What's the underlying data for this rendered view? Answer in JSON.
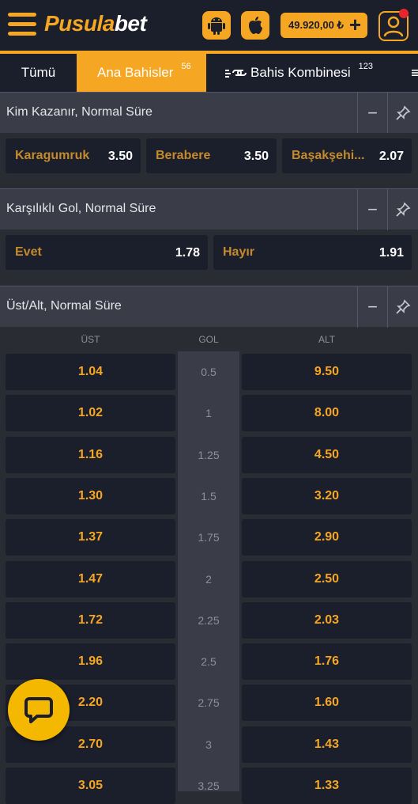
{
  "header": {
    "logo_part1": "Pusula",
    "logo_part2": "bet",
    "balance": "49.920,00 ₺",
    "balance_plus": "+"
  },
  "tabs": [
    {
      "label": "Tümü",
      "count": ""
    },
    {
      "label": "Ana Bahisler",
      "count": "56"
    },
    {
      "label": "Bahis Kombinesi",
      "count": "123"
    }
  ],
  "sections": {
    "winner": {
      "title": "Kim Kazanır, Normal Süre",
      "options": [
        {
          "label": "Karagumruk",
          "odd": "3.50"
        },
        {
          "label": "Berabere",
          "odd": "3.50"
        },
        {
          "label": "Başakşehi...",
          "odd": "2.07"
        }
      ]
    },
    "btts": {
      "title": "Karşılıklı Gol, Normal Süre",
      "options": [
        {
          "label": "Evet",
          "odd": "1.78"
        },
        {
          "label": "Hayır",
          "odd": "1.91"
        }
      ]
    },
    "overunder": {
      "title": "Üst/Alt, Normal Süre",
      "col_over": "ÜST",
      "col_goal": "GOL",
      "col_under": "ALT",
      "rows": [
        {
          "over": "1.04",
          "goal": "0.5",
          "under": "9.50"
        },
        {
          "over": "1.02",
          "goal": "1",
          "under": "8.00"
        },
        {
          "over": "1.16",
          "goal": "1.25",
          "under": "4.50"
        },
        {
          "over": "1.30",
          "goal": "1.5",
          "under": "3.20"
        },
        {
          "over": "1.37",
          "goal": "1.75",
          "under": "2.90"
        },
        {
          "over": "1.47",
          "goal": "2",
          "under": "2.50"
        },
        {
          "over": "1.72",
          "goal": "2.25",
          "under": "2.03"
        },
        {
          "over": "1.96",
          "goal": "2.5",
          "under": "1.76"
        },
        {
          "over": "2.20",
          "goal": "2.75",
          "under": "1.60"
        },
        {
          "over": "2.70",
          "goal": "3",
          "under": "1.43"
        },
        {
          "over": "3.05",
          "goal": "3.25",
          "under": "1.33"
        }
      ]
    }
  },
  "colors": {
    "accent": "#f5a623",
    "dark": "#1b1e2b",
    "panel": "#3a3d48",
    "notification": "#e8262c"
  }
}
